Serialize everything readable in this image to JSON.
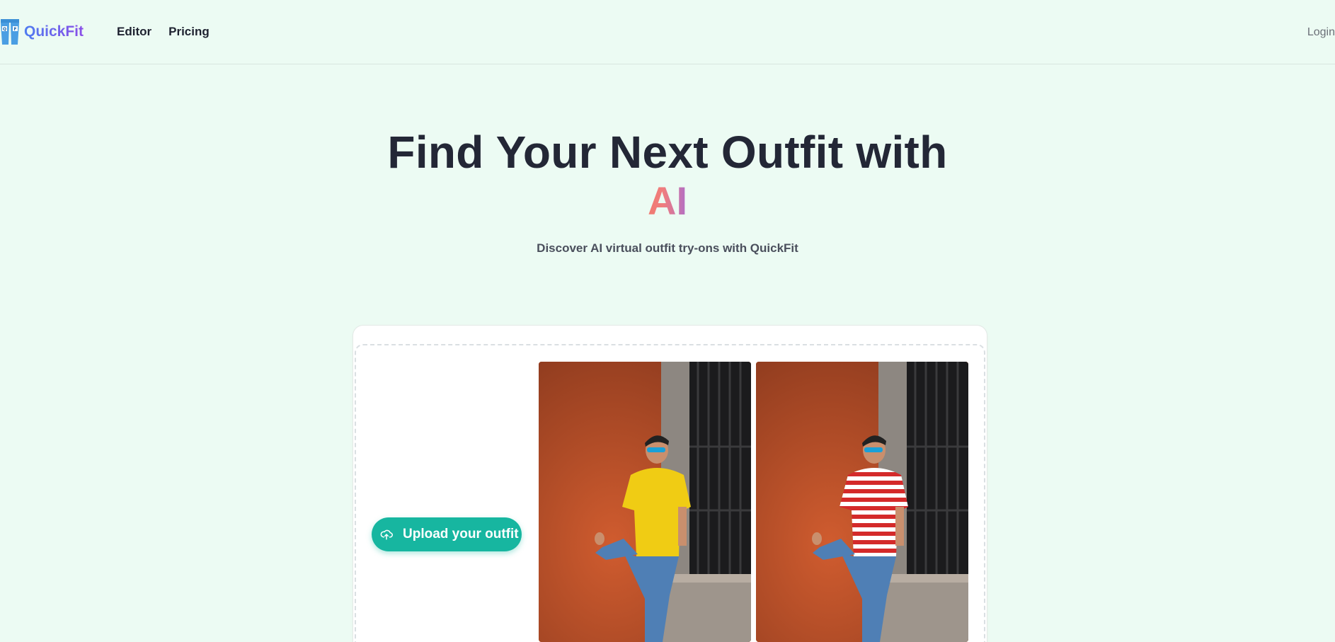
{
  "brand": {
    "name": "QuickFit",
    "logo_letters": "QF"
  },
  "nav": {
    "items": [
      {
        "label": "Editor"
      },
      {
        "label": "Pricing"
      }
    ]
  },
  "header": {
    "login_label": "Login"
  },
  "hero": {
    "title": "Find Your Next Outfit with",
    "title_highlight": "AI",
    "subtitle": "Discover AI virtual outfit try-ons with QuickFit"
  },
  "upload": {
    "label": "Upload your outfit",
    "icon": "cloud-upload-icon"
  },
  "photos": [
    {
      "name": "original-photo",
      "shirt": "yellow t-shirt"
    },
    {
      "name": "tryon-photo",
      "shirt": "red and white striped t-shirt"
    }
  ],
  "colors": {
    "background": "#ecfbf3",
    "accent": "#17b6a0",
    "brand_gradient_start": "#4f7df0",
    "brand_gradient_end": "#8a4ee8",
    "ai_gradient_start": "#f17a70",
    "ai_gradient_end": "#b06ec8"
  }
}
